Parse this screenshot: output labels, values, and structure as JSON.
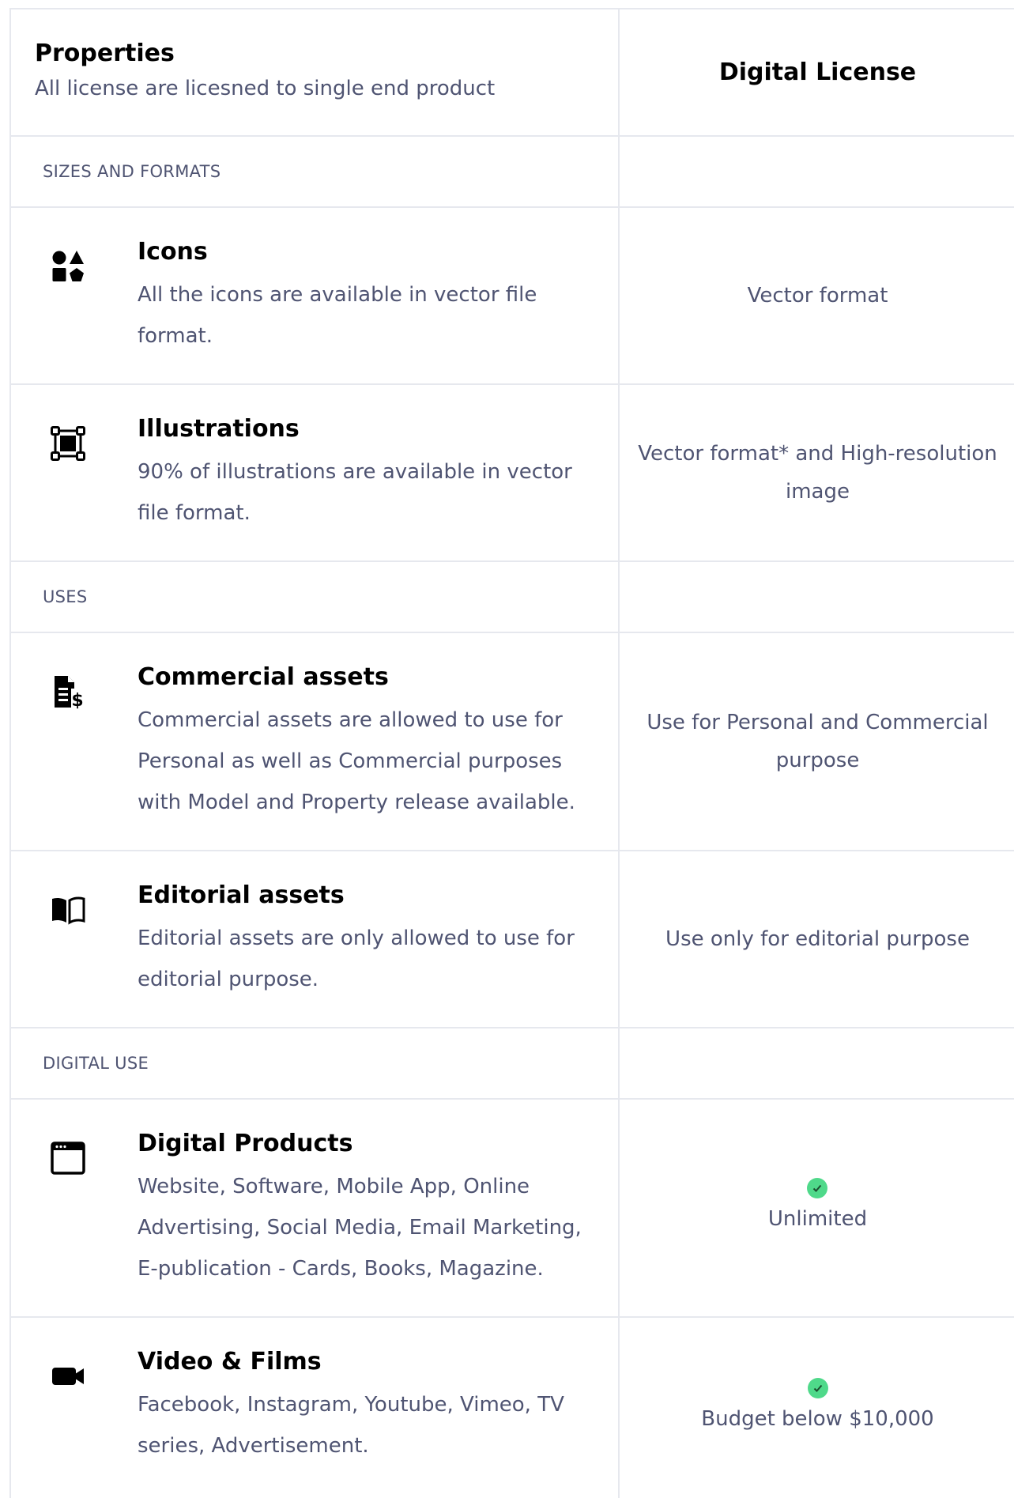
{
  "header": {
    "title": "Properties",
    "subtitle": "All license are licesned to single end product",
    "column_title": "Digital License"
  },
  "sections": [
    {
      "label": "SIZES AND FORMATS",
      "items": [
        {
          "icon": "shapes-icon",
          "title": "Icons",
          "description": "All the icons are available in vector file format.",
          "value": "Vector format"
        },
        {
          "icon": "vector-frame-icon",
          "title": "Illustrations",
          "description": "90% of illustrations are available in vector file format.",
          "value": "Vector format* and High-resolution image"
        }
      ]
    },
    {
      "label": "USES",
      "items": [
        {
          "icon": "file-dollar-icon",
          "title": "Commercial assets",
          "description": "Commercial assets are allowed to use for Personal as well as Commercial purposes with Model and Property release available.",
          "value": "Use for Personal and Commercial purpose"
        },
        {
          "icon": "open-book-icon",
          "title": "Editorial assets",
          "description": "Editorial assets are only allowed to use for editorial purpose.",
          "value": "Use only for editorial purpose"
        }
      ]
    },
    {
      "label": "DIGITAL USE",
      "items": [
        {
          "icon": "browser-window-icon",
          "title": "Digital Products",
          "description": "Website, Software, Mobile App, Online Advertising, Social Media, Email Marketing, E-publication - Cards, Books, Magazine.",
          "value": "Unlimited",
          "checked": true
        },
        {
          "icon": "video-camera-icon",
          "title": "Video & Films",
          "description": "Facebook, Instagram, Youtube, Vimeo, TV series, Advertisement.",
          "value": "Budget below $10,000",
          "checked": true
        }
      ]
    }
  ],
  "colors": {
    "text_primary": "#000000",
    "text_secondary": "#4f5472",
    "border": "#e6e8ee",
    "check_green": "#4fd98a"
  }
}
